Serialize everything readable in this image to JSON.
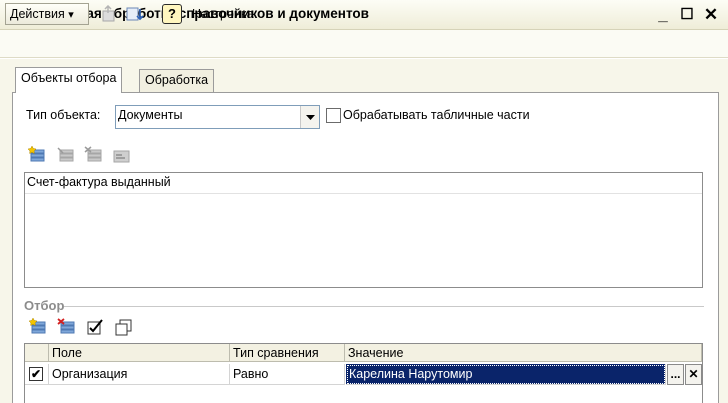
{
  "window": {
    "title": "Групповая обработка справочников и документов",
    "minimize_label": "_",
    "maximize_label": "☐",
    "close_label": "✕"
  },
  "toolbar": {
    "actions_label": "Действия",
    "actions_arrow": "▾",
    "help_label": "?",
    "settings_label": "Настройка"
  },
  "tabs": [
    {
      "label": "Объекты отбора"
    },
    {
      "label": "Обработка"
    }
  ],
  "object_type": {
    "label": "Тип объекта:",
    "value": "Документы",
    "process_tabular_label": "Обрабатывать табличные части"
  },
  "objects_list": {
    "items": [
      "Счет-фактура выданный"
    ]
  },
  "filter": {
    "caption": "Отбор",
    "columns": [
      "Поле",
      "Тип сравнения",
      "Значение"
    ],
    "rows": [
      {
        "checked": "✔",
        "field": "Организация",
        "comparison": "Равно",
        "value": "Карелина Нарутомир"
      }
    ],
    "select_button_label": "...",
    "clear_button_label": "✕"
  },
  "colors": {
    "selection": "#0a246a",
    "titlebar": "#efedd8"
  }
}
